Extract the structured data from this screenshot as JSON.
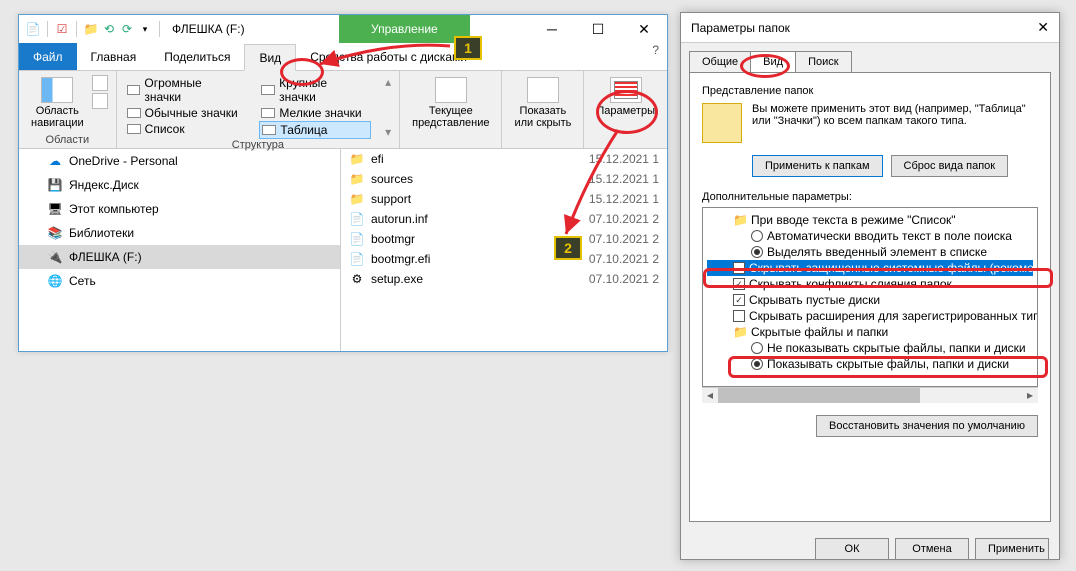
{
  "explorer": {
    "title": "ФЛЕШКА (F:)",
    "manage": "Управление",
    "tabs": {
      "file": "Файл",
      "home": "Главная",
      "share": "Поделиться",
      "view": "Вид",
      "tools": "Средства работы с дисками"
    },
    "ribbon": {
      "panes": {
        "label": "Области",
        "nav": "Область\nнавигации"
      },
      "layout": {
        "label": "Структура",
        "huge": "Огромные значки",
        "large": "Крупные значки",
        "normal": "Обычные значки",
        "small": "Мелкие значки",
        "list": "Список",
        "table": "Таблица"
      },
      "currentview": {
        "label": "Текущее\nпредставление"
      },
      "showhide": {
        "label": "Показать\nили скрыть"
      },
      "options": "Параметры"
    },
    "tree": {
      "onedrive": "OneDrive - Personal",
      "yandex": "Яндекс.Диск",
      "thispc": "Этот компьютер",
      "libraries": "Библиотеки",
      "flash": "ФЛЕШКА (F:)",
      "network": "Сеть"
    },
    "files": [
      {
        "ico": "folder",
        "name": "efi",
        "date": "15.12.2021 1"
      },
      {
        "ico": "folder",
        "name": "sources",
        "date": "15.12.2021 1"
      },
      {
        "ico": "folder",
        "name": "support",
        "date": "15.12.2021 1"
      },
      {
        "ico": "file",
        "name": "autorun.inf",
        "date": "07.10.2021 2"
      },
      {
        "ico": "file",
        "name": "bootmgr",
        "date": "07.10.2021 2"
      },
      {
        "ico": "file",
        "name": "bootmgr.efi",
        "date": "07.10.2021 2"
      },
      {
        "ico": "exe",
        "name": "setup.exe",
        "date": "07.10.2021 2"
      }
    ]
  },
  "dialog": {
    "title": "Параметры папок",
    "tabs": {
      "general": "Общие",
      "view": "Вид",
      "search": "Поиск"
    },
    "fv_label": "Представление папок",
    "fv_text": "Вы можете применить этот вид (например, \"Таблица\" или \"Значки\") ко всем папкам такого типа.",
    "apply_folders": "Применить к папкам",
    "reset_folders": "Сброс вида папок",
    "opts_label": "Дополнительные параметры:",
    "opts": [
      {
        "t": "folder",
        "txt": "При вводе текста в режиме \"Список\""
      },
      {
        "t": "radio",
        "on": false,
        "sub": true,
        "txt": "Автоматически вводить текст в поле поиска"
      },
      {
        "t": "radio",
        "on": true,
        "sub": true,
        "txt": "Выделять введенный элемент в списке"
      },
      {
        "t": "check",
        "on": false,
        "sel": true,
        "txt": "Скрывать защищенные системные файлы (рекомен"
      },
      {
        "t": "check",
        "on": true,
        "txt": "Скрывать конфликты слияния папок"
      },
      {
        "t": "check",
        "on": true,
        "txt": "Скрывать пустые диски"
      },
      {
        "t": "check",
        "on": false,
        "txt": "Скрывать расширения для зарегистрированных типо"
      },
      {
        "t": "folder",
        "txt": "Скрытые файлы и папки"
      },
      {
        "t": "radio",
        "on": false,
        "sub": true,
        "txt": "Не показывать скрытые файлы, папки и диски"
      },
      {
        "t": "radio",
        "on": true,
        "sub": true,
        "txt": "Показывать скрытые файлы, папки и диски"
      }
    ],
    "restore": "Восстановить значения по умолчанию",
    "ok": "ОК",
    "cancel": "Отмена",
    "apply": "Применить"
  },
  "badges": {
    "one": "1",
    "two": "2"
  }
}
